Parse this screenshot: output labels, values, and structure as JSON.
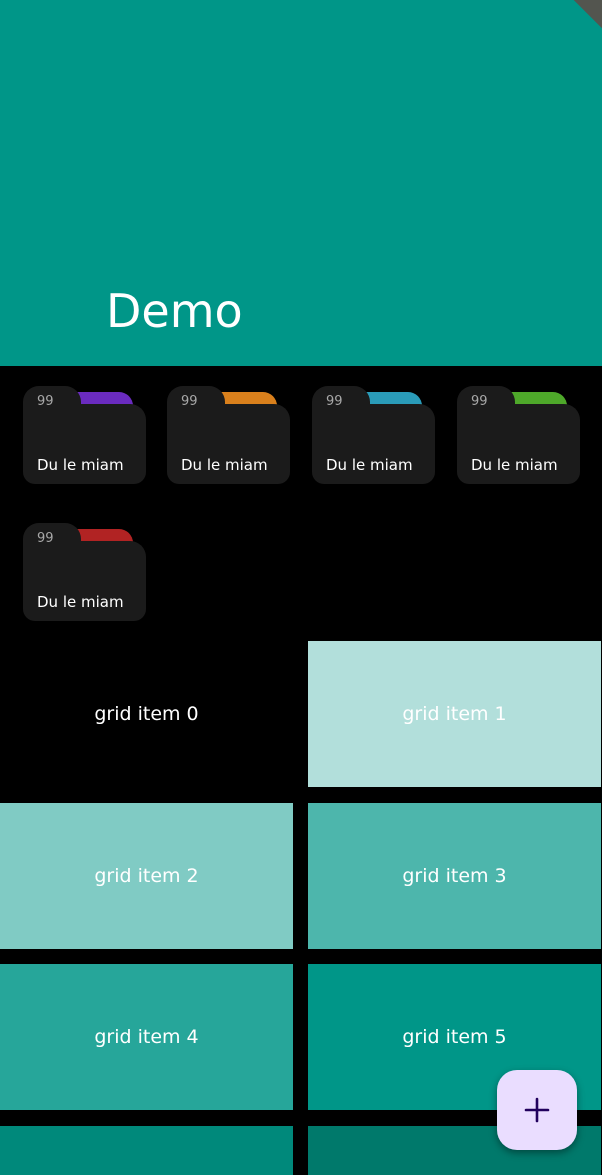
{
  "header": {
    "title": "Demo",
    "background": "#009688"
  },
  "folders": [
    {
      "count": "99",
      "label": "Du le miam",
      "accent": "#6a2bbf"
    },
    {
      "count": "99",
      "label": "Du le miam",
      "accent": "#d9801c"
    },
    {
      "count": "99",
      "label": "Du le miam",
      "accent": "#2a9bb8"
    },
    {
      "count": "99",
      "label": "Du le miam",
      "accent": "#4ea82a"
    },
    {
      "count": "99",
      "label": "Du le miam",
      "accent": "#b12323"
    }
  ],
  "grid": [
    {
      "label": "grid item 0",
      "color": "#000000"
    },
    {
      "label": "grid item 1",
      "color": "#b2dfdb"
    },
    {
      "label": "grid item 2",
      "color": "#80cbc4"
    },
    {
      "label": "grid item 3",
      "color": "#4db6ac"
    },
    {
      "label": "grid item 4",
      "color": "#26a69a"
    },
    {
      "label": "grid item 5",
      "color": "#009688"
    },
    {
      "label": "",
      "color": "#00897b"
    },
    {
      "label": "",
      "color": "#00796b"
    }
  ],
  "fab": {
    "icon": "plus-icon",
    "background": "#eaddff",
    "icon_color": "#21005d"
  }
}
